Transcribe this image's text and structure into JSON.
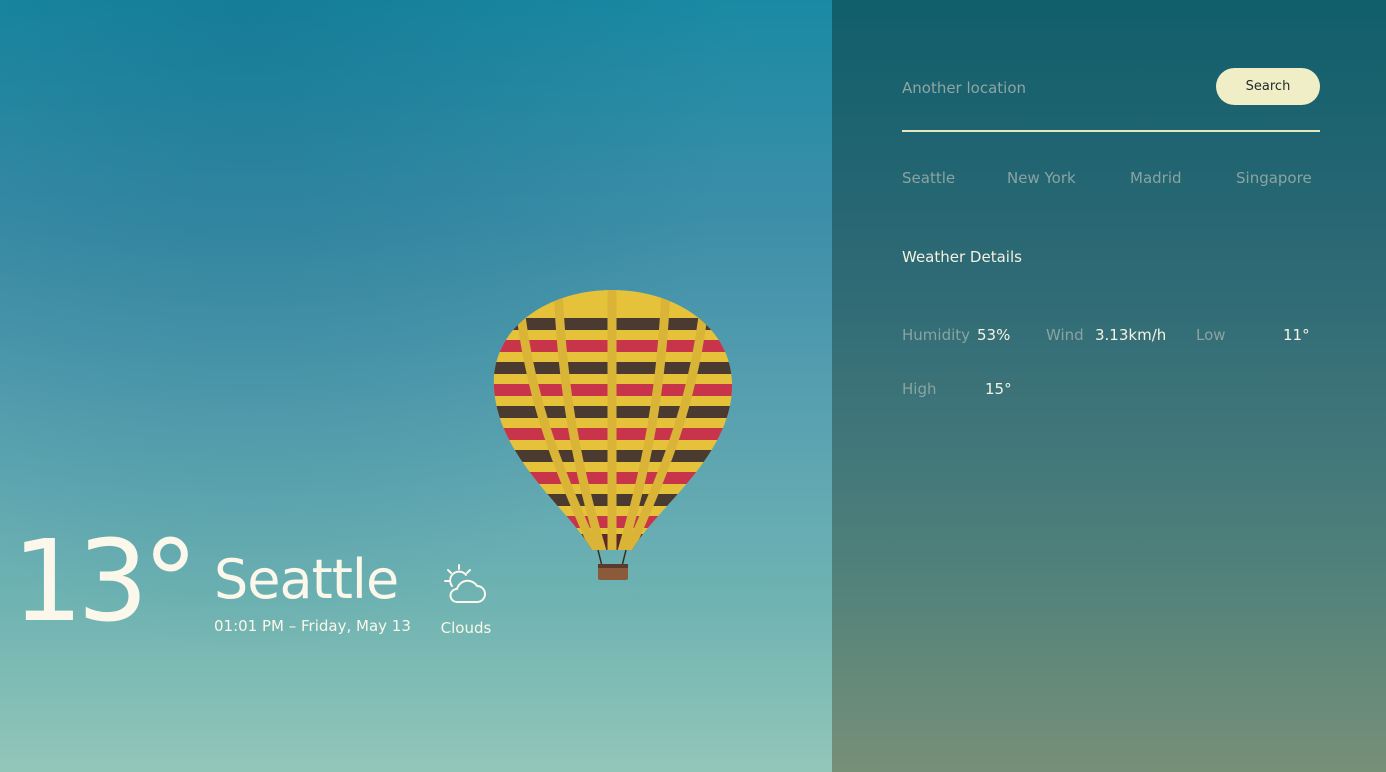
{
  "current": {
    "temperature": "13°",
    "city": "Seattle",
    "datetime": "01:01 PM – Friday, May 13",
    "condition": "Clouds",
    "condition_icon": "partly-cloudy-icon"
  },
  "search": {
    "placeholder": "Another location",
    "button_label": "Search"
  },
  "cities": [
    "Seattle",
    "New York",
    "Madrid",
    "Singapore"
  ],
  "details": {
    "title": "Weather Details",
    "humidity": {
      "label": "Humidity",
      "value": "53%"
    },
    "wind": {
      "label": "Wind",
      "value": "3.13km/h"
    },
    "low": {
      "label": "Low",
      "value": "11°"
    },
    "high": {
      "label": "High",
      "value": "15°"
    }
  },
  "colors": {
    "accent": "#f0eec6",
    "text_light": "#fbf7ea",
    "text_muted": "#8aa4a2"
  }
}
